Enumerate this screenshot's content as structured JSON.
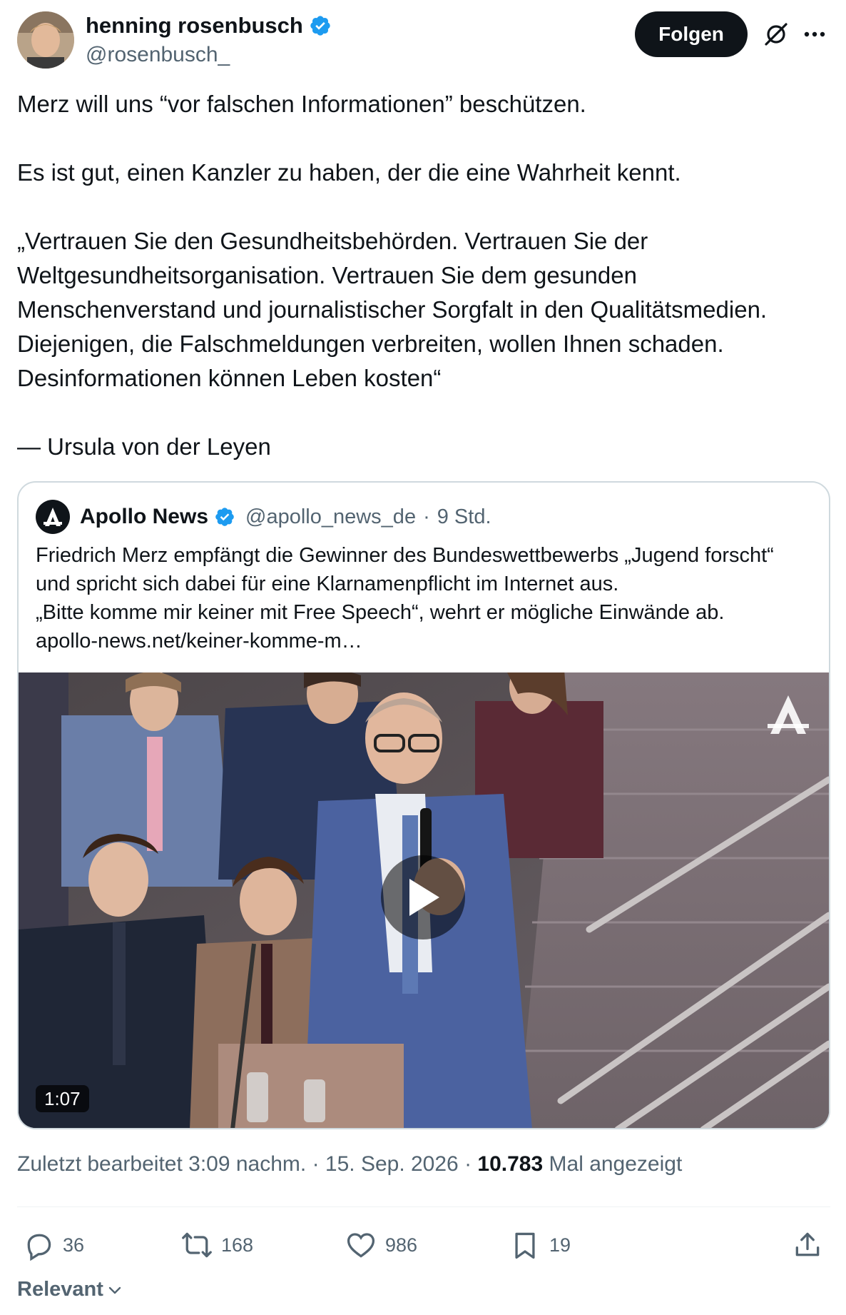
{
  "author": {
    "name": "henning rosenbusch",
    "handle": "@rosenbusch_",
    "verified": true,
    "verified_color": "#1d9bf0",
    "avatar_icon": "profile-photo"
  },
  "header": {
    "follow_label": "Folgen",
    "grok_icon": "grok-icon",
    "more_icon": "more-icon"
  },
  "tweet": {
    "paragraphs": [
      "Merz will uns “vor falschen Informationen” beschützen.",
      "Es ist gut, einen Kanzler zu haben, der die eine Wahrheit kennt.",
      "„Vertrauen Sie den Gesundheitsbehörden. Vertrauen Sie der Weltgesundheitsorganisation. Vertrauen Sie dem gesunden Menschenverstand und journalistischer Sorgfalt in den Qualitätsmedien. Diejenigen, die Falschmeldungen verbreiten, wollen Ihnen schaden. Desinformationen können Leben kosten“",
      "— Ursula von der Leyen"
    ]
  },
  "quote": {
    "name": "Apollo News",
    "handle": "@apollo_news_de",
    "separator": "·",
    "time": "9 Std.",
    "text_lines": [
      "Friedrich Merz empfängt die Gewinner des Bundeswettbewerbs „Jugend forscht“ und spricht sich dabei für eine Klarnamenpflicht im Internet aus.",
      "„Bitte komme mir keiner mit Free Speech“, wehrt er mögliche Einwände ab.",
      "apollo-news.net/keiner-komme-m…"
    ],
    "video": {
      "duration": "1:07",
      "play_icon": "play-icon"
    }
  },
  "meta": {
    "edited": "Zuletzt bearbeitet 3:09 nachm.",
    "date": "15. Sep. 2026",
    "views_count": "10.783",
    "views_label": "Mal angezeigt"
  },
  "actions": {
    "replies": "36",
    "reposts": "168",
    "likes": "986",
    "bookmarks": "19"
  },
  "sort": {
    "label": "Relevant"
  }
}
